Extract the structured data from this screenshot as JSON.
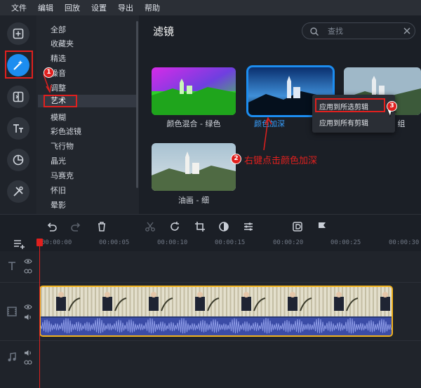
{
  "menu": [
    "文件",
    "编辑",
    "回放",
    "设置",
    "导出",
    "帮助"
  ],
  "tools": [
    {
      "name": "import-icon"
    },
    {
      "name": "filters-magic-wand-icon"
    },
    {
      "name": "transitions-icon"
    },
    {
      "name": "titles-icon"
    },
    {
      "name": "stickers-icon"
    },
    {
      "name": "more-tools-icon"
    }
  ],
  "categories": [
    "全部",
    "收藏夹",
    "精选",
    "噪音",
    "调整",
    "艺术",
    "模糊",
    "彩色滤镜",
    "飞行物",
    "晶光",
    "马赛克",
    "怀旧",
    "晕影"
  ],
  "active_category": "艺术",
  "pane": {
    "title": "滤镜",
    "search_placeholder": "查找"
  },
  "filters": [
    {
      "label": "颜色混合 - 绿色",
      "selected": false
    },
    {
      "label": "颜色加深",
      "selected": true
    },
    {
      "label": "组",
      "selected": false
    },
    {
      "label": "油画 - 细",
      "selected": false
    }
  ],
  "context_menu": {
    "items": [
      "应用到所选剪辑",
      "应用到所有剪辑"
    ]
  },
  "badges": [
    "1",
    "2",
    "3"
  ],
  "annotation": "右键点击颜色加深",
  "timeline": {
    "ticks": [
      "00:00:00",
      "00:00:05",
      "00:00:10",
      "00:00:15",
      "00:00:20",
      "00:00:25",
      "00:00:30"
    ]
  },
  "colors": {
    "accent": "#1c8df0",
    "annotation_red": "#e0201e",
    "clip_border": "#f2b21c",
    "audio_wave": "#8e9ce8"
  }
}
